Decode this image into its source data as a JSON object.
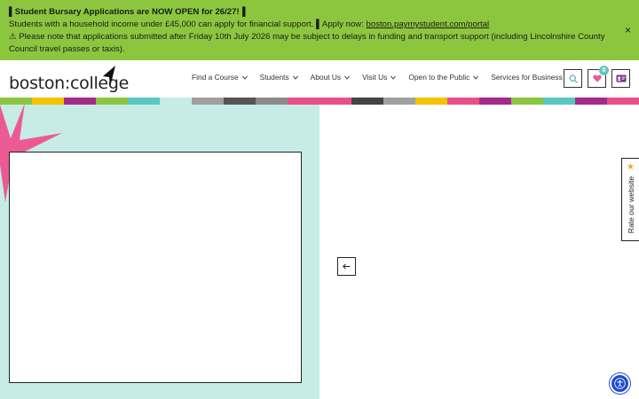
{
  "alert": {
    "line1": "▌Student Bursary Applications are NOW OPEN for 26/27!▐",
    "line2_text": "Students with a household income under £45,000 can apply for financial support. ▌Apply now: ",
    "line2_link": "boston.paymystudent.com/portal",
    "line3": "⚠ Please note that applications submitted after Friday 10th July 2026 may be subject to delays in funding and transport support (including Lincolnshire County Council travel passes or taxis).",
    "close_glyph": "×"
  },
  "header": {
    "logo_text": "boston:college",
    "nav": [
      {
        "label": "Find a Course"
      },
      {
        "label": "Students"
      },
      {
        "label": "About Us"
      },
      {
        "label": "Visit Us"
      },
      {
        "label": "Open to the Public"
      },
      {
        "label": "Services for Business"
      }
    ],
    "favourites_count": "0",
    "icons": {
      "search": "search-icon",
      "favourites": "heart-icon",
      "id_card": "id-card-icon"
    }
  },
  "stripe_colors": [
    "#8cc63f",
    "#f5c200",
    "#a52a8c",
    "#8cc63f",
    "#5bc8c0",
    "#c6ece5",
    "#a0a0a0",
    "#555555",
    "#8a8a8a",
    "#e84f8a",
    "#e84f8a",
    "#444444",
    "#a0a0a0",
    "#f5c200",
    "#e84f8a",
    "#a52a8c",
    "#8cc63f",
    "#5bc8c0",
    "#a52a8c",
    "#e84f8a"
  ],
  "colors": {
    "alert_bg": "#8cc63f",
    "hero_bg": "#c6ece5",
    "accent_pink": "#ec5a96",
    "a11y_blue": "#1e4bd2"
  },
  "carousel": {
    "prev_icon": "arrow-left-icon"
  },
  "rate_tab": {
    "label": "Rate our website",
    "star": "★"
  }
}
